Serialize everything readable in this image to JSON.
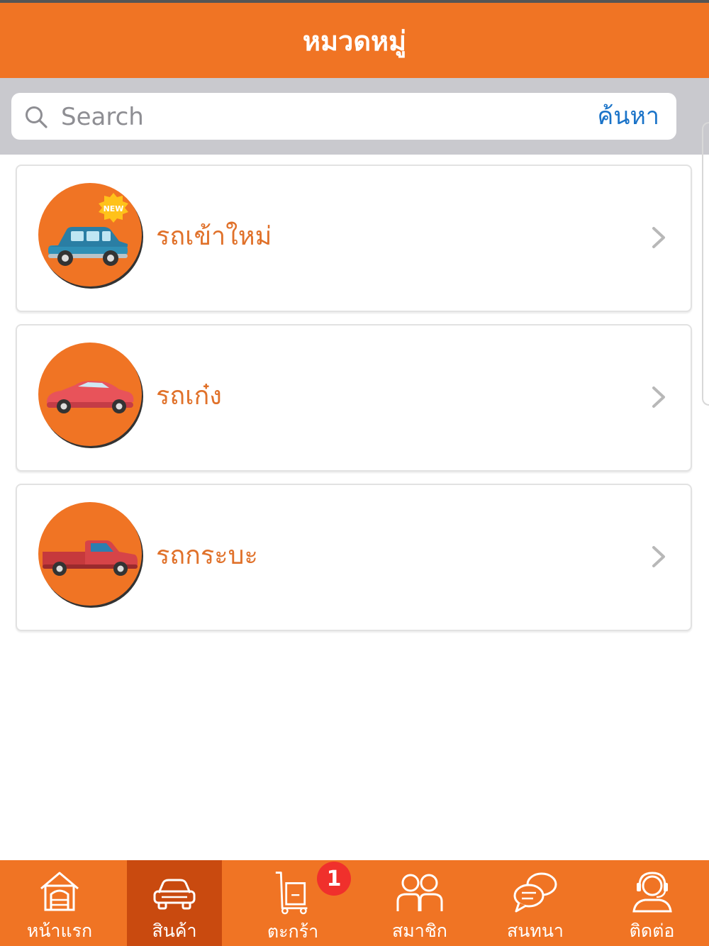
{
  "header": {
    "title": "หมวดหมู่"
  },
  "search": {
    "placeholder": "Search",
    "button_label": "ค้นหา"
  },
  "categories": [
    {
      "label": "รถเข้าใหม่",
      "icon": "new-car-icon",
      "badge": "NEW"
    },
    {
      "label": "รถเก๋ง",
      "icon": "sedan-car-icon"
    },
    {
      "label": "รถกระบะ",
      "icon": "pickup-truck-icon"
    }
  ],
  "tabbar": {
    "items": [
      {
        "label": "หน้าแรก",
        "icon": "home-icon",
        "active": false
      },
      {
        "label": "สินค้า",
        "icon": "car-icon",
        "active": true
      },
      {
        "label": "ตะกร้า",
        "icon": "cart-icon",
        "active": false,
        "badge": "1"
      },
      {
        "label": "สมาชิก",
        "icon": "members-icon",
        "active": false
      },
      {
        "label": "สนทนา",
        "icon": "chat-icon",
        "active": false
      },
      {
        "label": "ติดต่อ",
        "icon": "contact-icon",
        "active": false
      }
    ]
  },
  "colors": {
    "primary": "#f07424",
    "active_tab": "#c94a0f",
    "link": "#1a73c8",
    "badge": "#f0302c"
  }
}
